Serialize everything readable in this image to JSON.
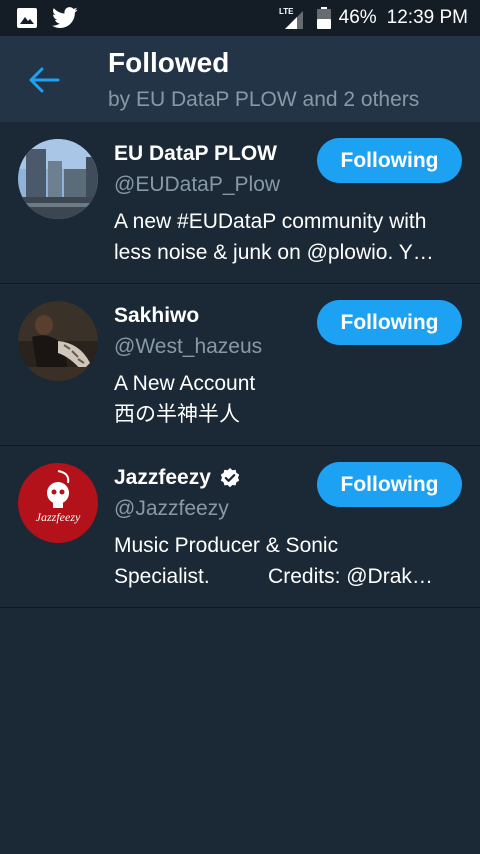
{
  "status_bar": {
    "icons_left": [
      "image-icon",
      "twitter-bird-icon"
    ],
    "network": "LTE",
    "battery": "46%",
    "time": "12:39 PM"
  },
  "header": {
    "title": "Followed",
    "subtitle": "by EU DataP PLOW and 2 others"
  },
  "colors": {
    "background": "#1b2836",
    "header": "#243447",
    "accent": "#1da1f2",
    "secondary_text": "#8899a6"
  },
  "users": [
    {
      "name": "EU DataP PLOW",
      "handle": "@EUDataP_Plow",
      "verified": false,
      "button": "Following",
      "bio": [
        "A new #EUDataP community with",
        "less noise & junk on @plowio. Y…"
      ]
    },
    {
      "name": "Sakhiwo",
      "handle": "@West_hazeus",
      "verified": false,
      "button": "Following",
      "bio": [
        "A New Account",
        "西の半神半人"
      ]
    },
    {
      "name": "Jazzfeezy",
      "handle": "@Jazzfeezy",
      "verified": true,
      "button": "Following",
      "bio": [
        "Music Producer & Sonic",
        "Specialist.          Credits: @Drak…"
      ],
      "avatar_text": "Jazzfeezy"
    }
  ]
}
